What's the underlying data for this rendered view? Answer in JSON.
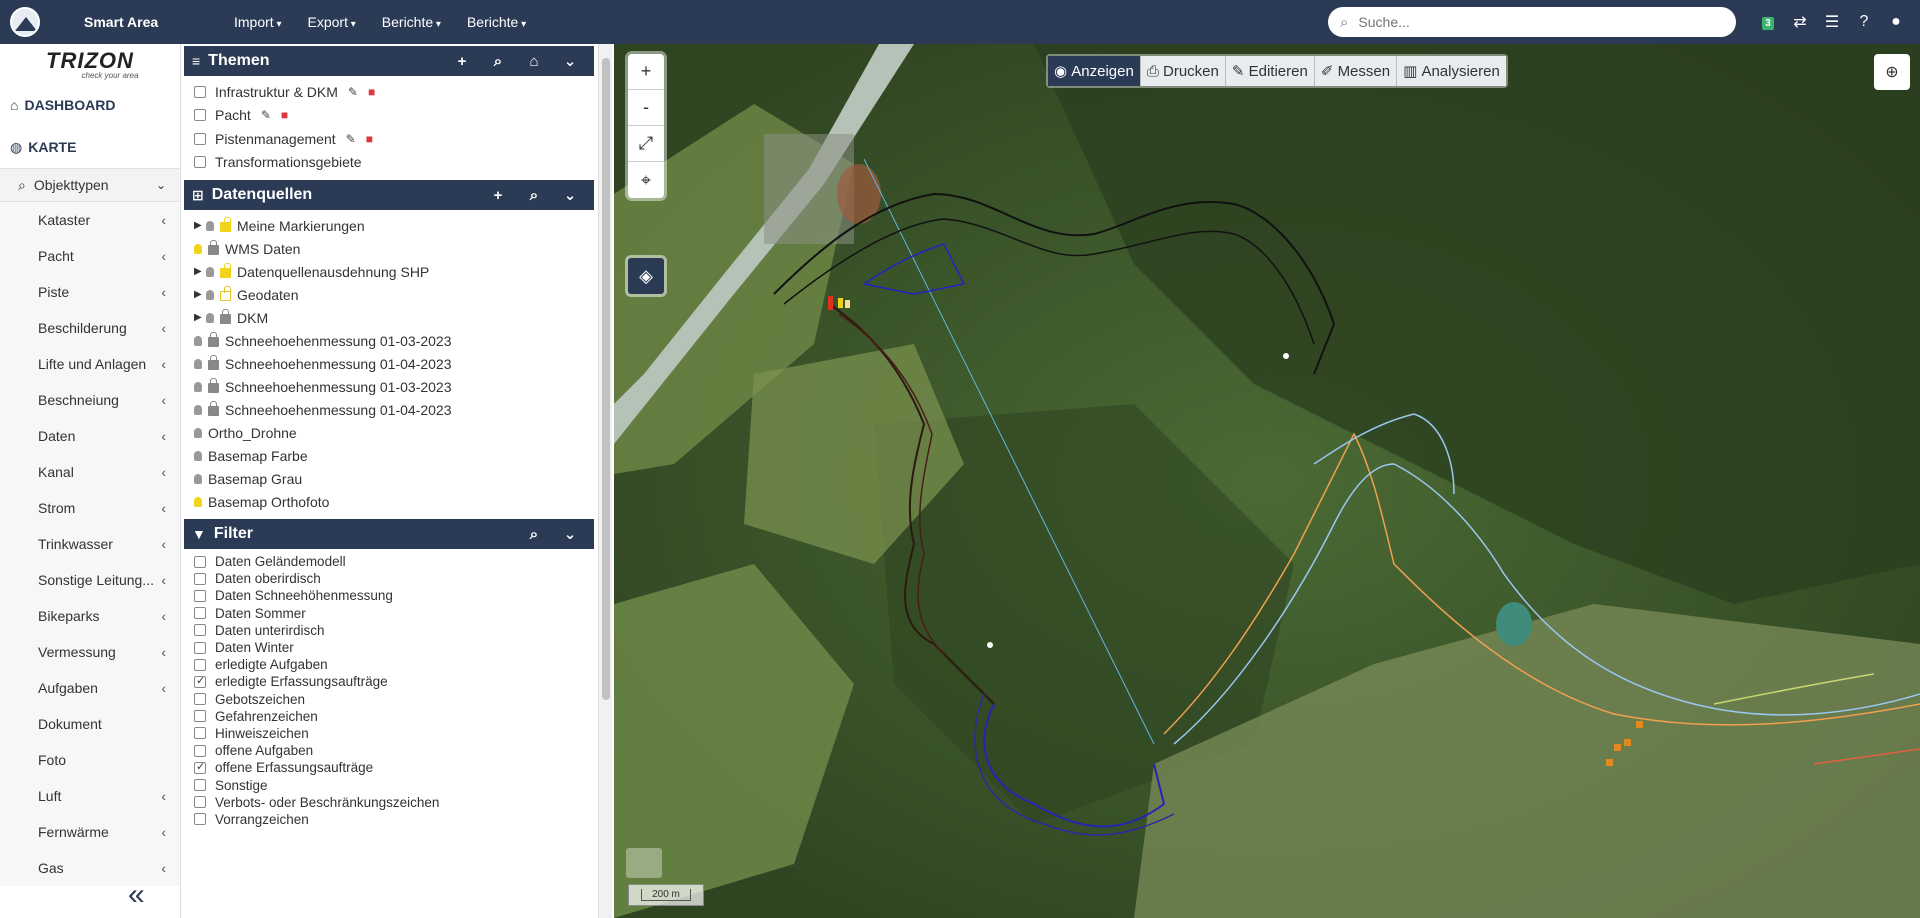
{
  "topbar": {
    "app_title": "Smart Area",
    "menu": [
      "Import",
      "Export",
      "Berichte",
      "Berichte"
    ],
    "search_placeholder": "Suche...",
    "badge_count": "3"
  },
  "sidebar": {
    "brand": "TRIZON",
    "brand_tagline": "check your area",
    "dashboard": "DASHBOARD",
    "karte": "KARTE",
    "objekttypen": "Objekttypen",
    "items": [
      {
        "label": "Kataster",
        "chev": true
      },
      {
        "label": "Pacht",
        "chev": true
      },
      {
        "label": "Piste",
        "chev": true
      },
      {
        "label": "Beschilderung",
        "chev": true
      },
      {
        "label": "Lifte und Anlagen",
        "chev": true
      },
      {
        "label": "Beschneiung",
        "chev": true
      },
      {
        "label": "Daten",
        "chev": true
      },
      {
        "label": "Kanal",
        "chev": true
      },
      {
        "label": "Strom",
        "chev": true
      },
      {
        "label": "Trinkwasser",
        "chev": true
      },
      {
        "label": "Sonstige Leitung...",
        "chev": true
      },
      {
        "label": "Bikeparks",
        "chev": true
      },
      {
        "label": "Vermessung",
        "chev": true
      },
      {
        "label": "Aufgaben",
        "chev": true
      },
      {
        "label": "Dokument",
        "chev": false
      },
      {
        "label": "Foto",
        "chev": false
      },
      {
        "label": "Luft",
        "chev": true
      },
      {
        "label": "Fernwärme",
        "chev": true
      },
      {
        "label": "Gas",
        "chev": true
      }
    ]
  },
  "themen": {
    "title": "Themen",
    "rows": [
      {
        "label": "Infrastruktur & DKM",
        "editable": true
      },
      {
        "label": "Pacht",
        "editable": true
      },
      {
        "label": "Pistenmanagement",
        "editable": true
      },
      {
        "label": "Transformationsgebiete",
        "editable": false
      }
    ]
  },
  "datenquellen": {
    "title": "Datenquellen",
    "rows": [
      {
        "label": "Meine Markierungen",
        "tree": true,
        "bulb": "off",
        "lock": "open"
      },
      {
        "label": "WMS Daten",
        "tree": false,
        "bulb": "on",
        "lock": "closed"
      },
      {
        "label": "Datenquellenausdehnung SHP",
        "tree": true,
        "bulb": "off",
        "lock": "open"
      },
      {
        "label": "Geodaten",
        "tree": true,
        "bulb": "off",
        "lock": "outline"
      },
      {
        "label": "DKM",
        "tree": true,
        "bulb": "off",
        "lock": "closed"
      },
      {
        "label": "Schneehoehenmessung 01-03-2023",
        "tree": false,
        "bulb": "off",
        "lock": "closed"
      },
      {
        "label": "Schneehoehenmessung 01-04-2023",
        "tree": false,
        "bulb": "off",
        "lock": "closed"
      },
      {
        "label": "Schneehoehenmessung 01-03-2023",
        "tree": false,
        "bulb": "off",
        "lock": "closed"
      },
      {
        "label": "Schneehoehenmessung 01-04-2023",
        "tree": false,
        "bulb": "off",
        "lock": "closed"
      },
      {
        "label": "Ortho_Drohne",
        "tree": false,
        "bulb": "off",
        "lock": "none"
      },
      {
        "label": "Basemap Farbe",
        "tree": false,
        "bulb": "off",
        "lock": "none"
      },
      {
        "label": "Basemap Grau",
        "tree": false,
        "bulb": "off",
        "lock": "none"
      },
      {
        "label": "Basemap Orthofoto",
        "tree": false,
        "bulb": "on",
        "lock": "none"
      }
    ]
  },
  "filter": {
    "title": "Filter",
    "rows": [
      {
        "label": "Daten Geländemodell",
        "checked": false
      },
      {
        "label": "Daten oberirdisch",
        "checked": false
      },
      {
        "label": "Daten Schneehöhenmessung",
        "checked": false
      },
      {
        "label": "Daten Sommer",
        "checked": false
      },
      {
        "label": "Daten unterirdisch",
        "checked": false
      },
      {
        "label": "Daten Winter",
        "checked": false
      },
      {
        "label": "erledigte Aufgaben",
        "checked": false
      },
      {
        "label": "erledigte Erfassungsaufträge",
        "checked": true
      },
      {
        "label": "Gebotszeichen",
        "checked": false
      },
      {
        "label": "Gefahrenzeichen",
        "checked": false
      },
      {
        "label": "Hinweiszeichen",
        "checked": false
      },
      {
        "label": "offene Aufgaben",
        "checked": false
      },
      {
        "label": "offene Erfassungsaufträge",
        "checked": true
      },
      {
        "label": "Sonstige",
        "checked": false
      },
      {
        "label": "Verbots- oder Beschränkungszeichen",
        "checked": false
      },
      {
        "label": "Vorrangzeichen",
        "checked": false
      }
    ]
  },
  "map": {
    "tools": [
      {
        "label": "Anzeigen",
        "icon": "eye-icon",
        "active": true
      },
      {
        "label": "Drucken",
        "icon": "print-icon",
        "active": false
      },
      {
        "label": "Editieren",
        "icon": "pencil-icon",
        "active": false
      },
      {
        "label": "Messen",
        "icon": "ruler-icon",
        "active": false
      },
      {
        "label": "Analysieren",
        "icon": "chart-icon",
        "active": false
      }
    ],
    "zoom_in": "+",
    "zoom_out": "-",
    "scale": "200 m"
  }
}
